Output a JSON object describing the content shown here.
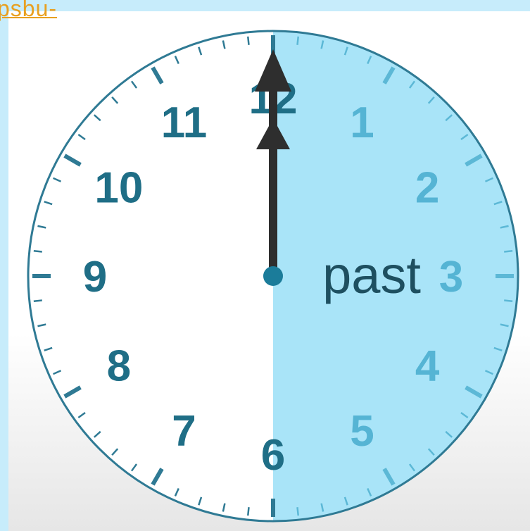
{
  "link": {
    "text": "psbu-"
  },
  "clock": {
    "numerals": [
      "12",
      "1",
      "2",
      "3",
      "4",
      "5",
      "6",
      "7",
      "8",
      "9",
      "10",
      "11"
    ],
    "label": "past",
    "minute_hand_value": 0,
    "hour_hand_value": 12,
    "shaded_half": "right",
    "colors": {
      "face": "#ffffff",
      "rim": "#2f7a94",
      "numeral": "#1f6e86",
      "numeral_shaded": "#55b4d4",
      "shade": "#a9e4f8",
      "hand": "#2e2e2e",
      "pivot": "#1b7c9a",
      "label": "#1e4f60",
      "background": "#c7ecfb",
      "link": "#e8a020"
    }
  }
}
